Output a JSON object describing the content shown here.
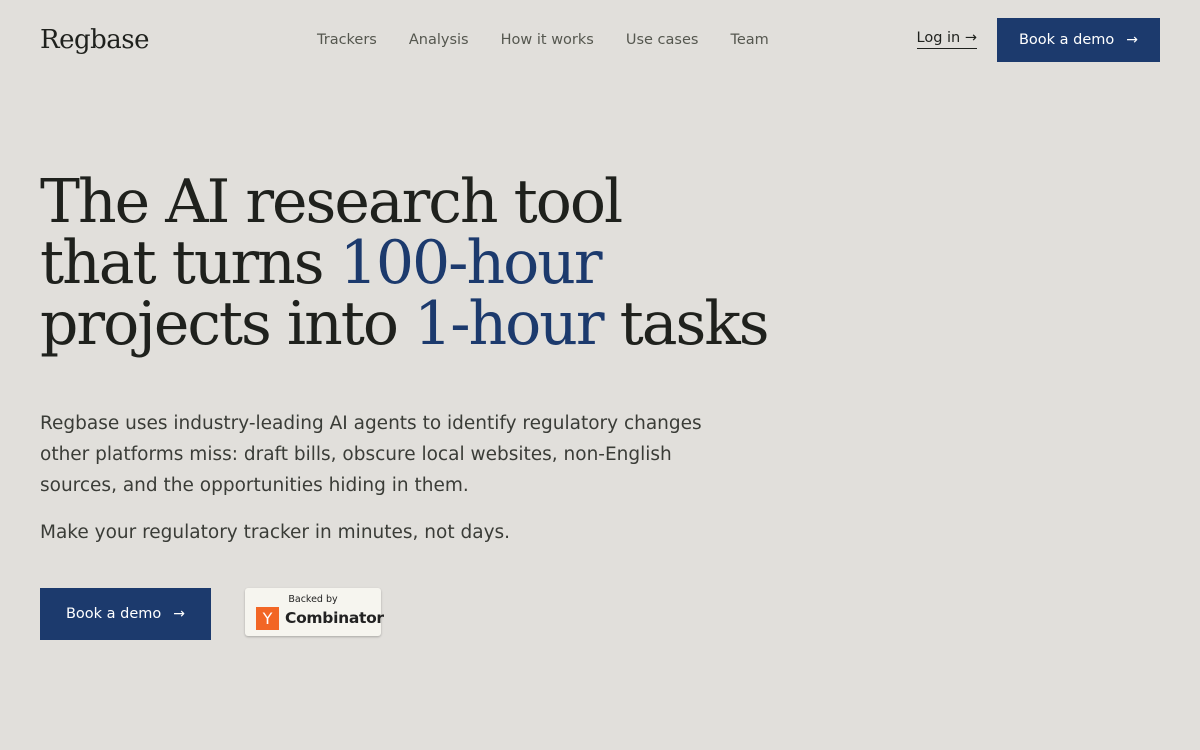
{
  "brand": {
    "name": "Regbase"
  },
  "nav": {
    "links": [
      "Trackers",
      "Analysis",
      "How it works",
      "Use cases",
      "Team"
    ],
    "login_label": "Log in",
    "login_arrow": "→",
    "demo_label": "Book a demo",
    "demo_arrow": "→"
  },
  "hero": {
    "headline": {
      "line1": "The AI research tool",
      "line2_pre": "that turns ",
      "line2_accent": "100-hour",
      "line3_pre": "projects into ",
      "line3_accent": "1-hour",
      "line3_post": " tasks"
    },
    "description": "Regbase uses industry-leading AI agents to identify regulatory changes other platforms miss: draft bills, obscure local websites, non-English sources, and the opportunities hiding in them.",
    "tagline": "Make your regulatory tracker in minutes, not days.",
    "cta_label": "Book a demo",
    "cta_arrow": "→"
  },
  "badge": {
    "top_text": "Backed by",
    "logo_letter": "Y",
    "name": "Combinator"
  },
  "colors": {
    "background": "#e1dfdb",
    "accent": "#1c3a6d",
    "yc_orange": "#f26625"
  }
}
